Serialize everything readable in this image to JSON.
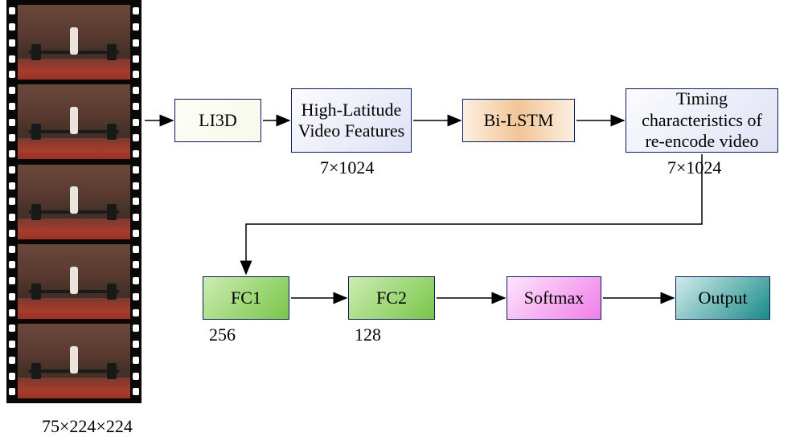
{
  "input": {
    "dimensions": "75×224×224"
  },
  "row1": {
    "li3d": "LI3D",
    "features": "High-Latitude\nVideo Features",
    "features_dim": "7×1024",
    "bilstm": "Bi-LSTM",
    "timing": "Timing\ncharacteristics of\nre-encode video",
    "timing_dim": "7×1024"
  },
  "row2": {
    "fc1": "FC1",
    "fc1_dim": "256",
    "fc2": "FC2",
    "fc2_dim": "128",
    "softmax": "Softmax",
    "output": "Output"
  },
  "chart_data": {
    "type": "table",
    "flow": [
      {
        "node": "Video frames",
        "shape": "75×224×224"
      },
      {
        "node": "LI3D"
      },
      {
        "node": "High-Latitude Video Features",
        "shape": "7×1024"
      },
      {
        "node": "Bi-LSTM"
      },
      {
        "node": "Timing characteristics of re-encode video",
        "shape": "7×1024"
      },
      {
        "node": "FC1",
        "units": 256
      },
      {
        "node": "FC2",
        "units": 128
      },
      {
        "node": "Softmax"
      },
      {
        "node": "Output"
      }
    ],
    "edges": [
      [
        "Video frames",
        "LI3D"
      ],
      [
        "LI3D",
        "High-Latitude Video Features"
      ],
      [
        "High-Latitude Video Features",
        "Bi-LSTM"
      ],
      [
        "Bi-LSTM",
        "Timing characteristics of re-encode video"
      ],
      [
        "Timing characteristics of re-encode video",
        "FC1"
      ],
      [
        "FC1",
        "FC2"
      ],
      [
        "FC2",
        "Softmax"
      ],
      [
        "Softmax",
        "Output"
      ]
    ]
  }
}
